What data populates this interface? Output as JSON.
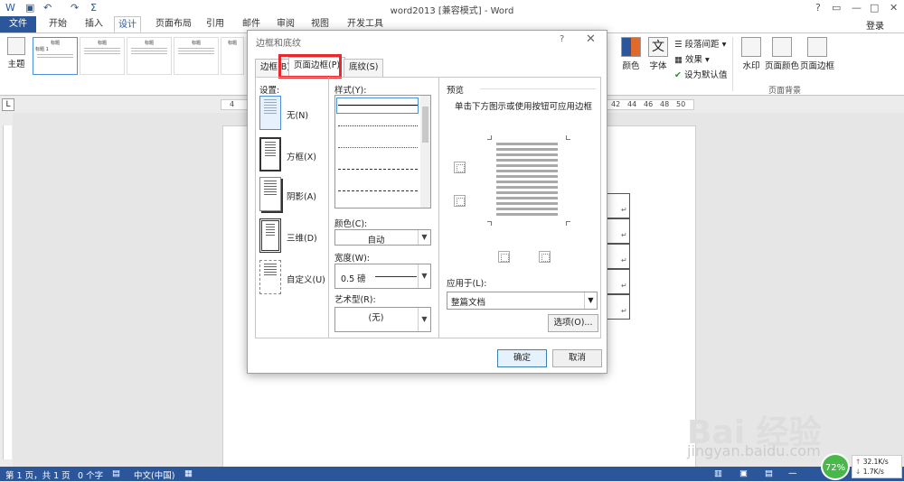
{
  "title_bar": {
    "doc_title": "word2013 [兼容模式] - Word",
    "help": "?",
    "restore": "▭",
    "minimize": "—",
    "maximize": "□",
    "close": "✕",
    "login": "登录"
  },
  "ribbon_tabs": [
    "文件",
    "开始",
    "插入",
    "设计",
    "页面布局",
    "引用",
    "邮件",
    "审阅",
    "视图",
    "开发工具"
  ],
  "ribbon": {
    "theme_label": "主题",
    "style_thumb_title": "标题",
    "style_thumb_title1": "标题 1",
    "colors_label": "颜色",
    "fonts_label": "字体",
    "para_spacing_label": "段落间距",
    "effects_label": "效果",
    "set_default_label": "设为默认值",
    "watermark_label": "水印",
    "page_color_label": "页面颜色",
    "page_border_label": "页面边框",
    "group_page_bg": "页面背景"
  },
  "ruler": {
    "left_mark": "4",
    "marks": [
      "42",
      "44",
      "46",
      "48",
      "50"
    ],
    "corner": "L"
  },
  "dialog": {
    "title": "边框和底纹",
    "help": "?",
    "close": "✕",
    "tabs": [
      "边框(B)",
      "页面边框(P)",
      "底纹(S)"
    ],
    "settings_label": "设置:",
    "settings": [
      "无(N)",
      "方框(X)",
      "阴影(A)",
      "三维(D)",
      "自定义(U)"
    ],
    "style_label": "样式(Y):",
    "color_label": "颜色(C):",
    "color_value": "自动",
    "width_label": "宽度(W):",
    "width_value": "0.5 磅",
    "art_label": "艺术型(R):",
    "art_value": "(无)",
    "preview_label": "预览",
    "preview_hint": "单击下方图示或使用按钮可应用边框",
    "apply_label": "应用于(L):",
    "apply_value": "整篇文档",
    "options_button": "选项(O)...",
    "ok": "确定",
    "cancel": "取消"
  },
  "status": {
    "page": "第 1 页，共 1 页",
    "words": "0 个字",
    "lang": "中文(中国)"
  },
  "watermark": {
    "brand": "Bai 经验",
    "url": "jingyan.baidu.com"
  },
  "net": {
    "percent": "72%",
    "up": "32.1K/s",
    "down": "1.7K/s"
  },
  "colors": {
    "accent": "#2b579a",
    "highlight": "#e8282c",
    "net_green": "#49b84a"
  }
}
